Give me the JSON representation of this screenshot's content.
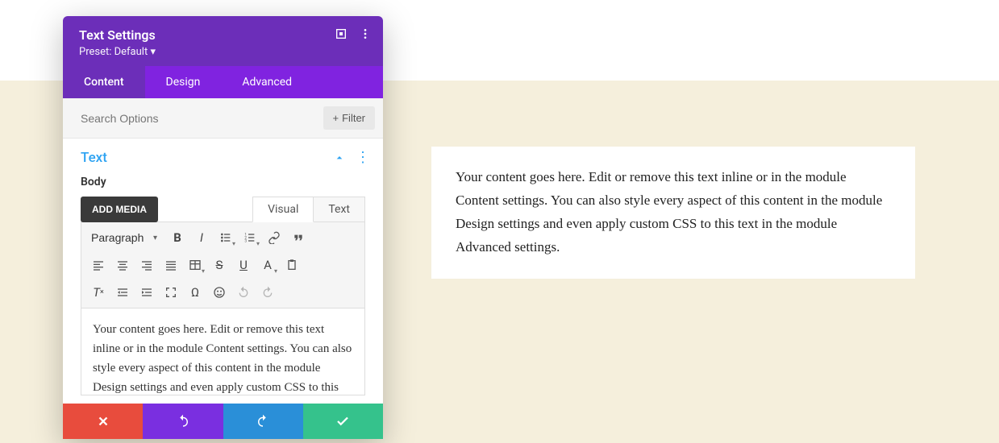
{
  "panel": {
    "title": "Text Settings",
    "preset_prefix": "Preset: ",
    "preset_value": "Default"
  },
  "tabs": {
    "content": "Content",
    "design": "Design",
    "advanced": "Advanced"
  },
  "search": {
    "placeholder": "Search Options",
    "filter_label": "Filter"
  },
  "section": {
    "title": "Text"
  },
  "body": {
    "label": "Body",
    "add_media": "ADD MEDIA",
    "tab_visual": "Visual",
    "tab_text": "Text",
    "format_select": "Paragraph",
    "text_a": "A",
    "content": "Your content goes here. Edit or remove this text inline or in the module Content settings. You can also style every aspect of this content in the module Design settings and even apply custom CSS to this text in the module Advanced settings."
  },
  "preview": {
    "content": "Your content goes here. Edit or remove this text inline or in the module Content settings. You can also style every aspect of this content in the module Design settings and even apply custom CSS to this text in the module Advanced settings."
  }
}
